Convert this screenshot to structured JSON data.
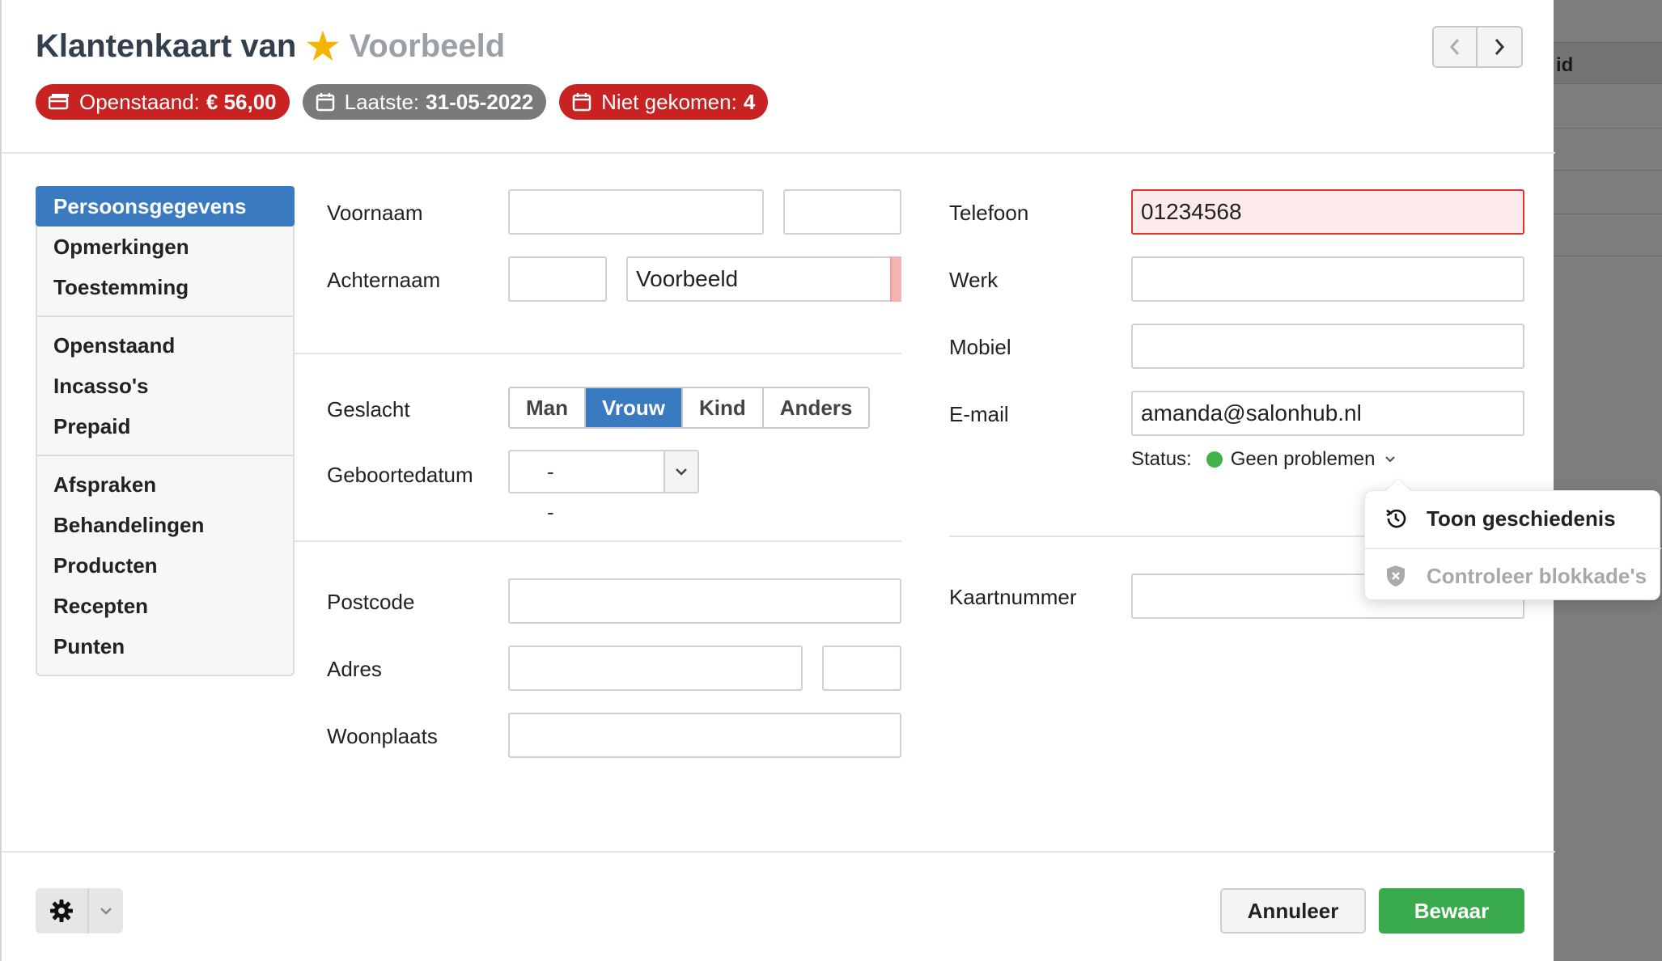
{
  "header": {
    "title_prefix": "Klantenkaart van",
    "title_name": "Voorbeeld",
    "badges": [
      {
        "label": "Openstaand:",
        "value": "€ 56,00",
        "color": "#c82222"
      },
      {
        "label": "Laatste:",
        "value": "31-05-2022",
        "color": "#7a7a7a"
      },
      {
        "label": "Niet gekomen:",
        "value": "4",
        "color": "#c82222"
      }
    ]
  },
  "background": {
    "column_header": "id"
  },
  "sidebar": {
    "groups": [
      [
        "Persoonsgegevens",
        "Opmerkingen",
        "Toestemming"
      ],
      [
        "Openstaand",
        "Incasso's",
        "Prepaid"
      ],
      [
        "Afspraken",
        "Behandelingen",
        "Producten",
        "Recepten",
        "Punten"
      ]
    ],
    "active": "Persoonsgegevens"
  },
  "form": {
    "voornaam_label": "Voornaam",
    "voornaam": "",
    "tussenvoegsel_first": "",
    "achternaam_label": "Achternaam",
    "achternaam_prefix": "",
    "achternaam": "Voorbeeld",
    "geslacht_label": "Geslacht",
    "geslacht_options": [
      "Man",
      "Vrouw",
      "Kind",
      "Anders"
    ],
    "geslacht_selected": "Vrouw",
    "geboortedatum_label": "Geboortedatum",
    "geboortedatum": "- -",
    "postcode_label": "Postcode",
    "postcode": "",
    "adres_label": "Adres",
    "adres": "",
    "huisnummer": "",
    "woonplaats_label": "Woonplaats",
    "woonplaats": "",
    "telefoon_label": "Telefoon",
    "telefoon": "01234568",
    "werk_label": "Werk",
    "werk": "",
    "mobiel_label": "Mobiel",
    "mobiel": "",
    "email_label": "E-mail",
    "email": "amanda@salonhub.nl",
    "status_label": "Status:",
    "status_value": "Geen problemen",
    "status_color": "#3fb24a",
    "kaartnummer_label": "Kaartnummer",
    "kaartnummer": ""
  },
  "popover": {
    "items": [
      "Toon geschiedenis",
      "Controleer blokkade's"
    ]
  },
  "footer": {
    "cancel_label": "Annuleer",
    "save_label": "Bewaar"
  },
  "colors": {
    "accent": "#3a7ac0",
    "danger": "#c82222",
    "success": "#3aab4c"
  }
}
